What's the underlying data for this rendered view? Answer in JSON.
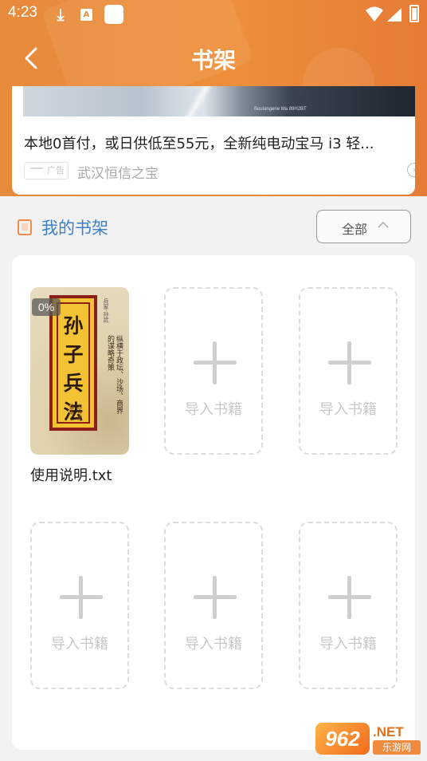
{
  "status_bar": {
    "time": "4:23",
    "notification_a": "A"
  },
  "nav": {
    "title": "书架"
  },
  "ad": {
    "text": "本地0首付，或日供低至55元，全新纯电动宝马 i3 轻...",
    "badge": "广告",
    "source": "武汉恒信之宝",
    "image_caption": "Boulangerie Ma 89H2BT"
  },
  "shelf": {
    "title": "我的书架",
    "filter_label": "全部",
    "books": [
      {
        "name": "使用说明.txt",
        "progress": "0%",
        "cover_title": "孙子兵法",
        "cover_subtitle": "古今通鉴本",
        "cover_author": "兵家·孙武",
        "cover_desc": "纵横于政坛、沙场、商界的谋略奇策"
      }
    ],
    "import_label": "导入书籍"
  },
  "watermark": {
    "number": "962",
    "domain": ".NET",
    "site": "乐游网"
  },
  "colors": {
    "header_orange": "#ee8e3a",
    "accent_blue": "#3c80ca",
    "shelf_icon_orange": "#f08b4a"
  }
}
